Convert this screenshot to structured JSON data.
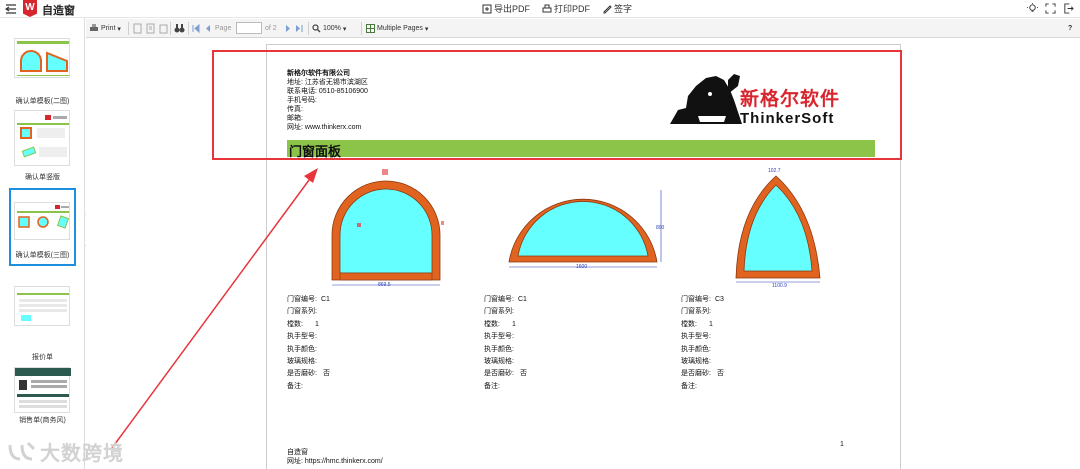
{
  "app": {
    "title": "自造窗",
    "logo_letter": "W",
    "actions": {
      "export_pdf": "导出PDF",
      "print_pdf": "打印PDF",
      "sign": "签字"
    }
  },
  "sidebar": {
    "items": [
      {
        "label": "确认单模板(二图)"
      },
      {
        "label": "确认单竖版"
      },
      {
        "label": "确认单模板(三图)"
      },
      {
        "label": "报价单"
      },
      {
        "label": "销售单(商务风)"
      }
    ],
    "collapse_glyph": "‹"
  },
  "viewer_toolbar": {
    "print": "Print",
    "page_label": "Page",
    "of_pages": "of 2",
    "zoom": "100%",
    "layout": "Multiple Pages",
    "help": "?"
  },
  "doc": {
    "company": {
      "name": "新格尔软件有限公司",
      "address": "地址: 江苏省无锡市滨湖区",
      "phone": "联系电话: 0510-85106900",
      "mobile": "手机号码:",
      "fax": "传真:",
      "email": "邮箱:",
      "website": "网址: www.thinkerx.com"
    },
    "brand": {
      "cn": "新格尔软件",
      "en": "ThinkerSoft"
    },
    "section_title": "门窗面板",
    "windows": [
      {
        "code_label": "门窗编号:",
        "code": "C1",
        "series_label": "门窗系列:",
        "series": "",
        "qty_label": "樘数:",
        "qty": "1",
        "handle_model_label": "执手型号:",
        "handle_model": "",
        "handle_color_label": "执手颜色:",
        "handle_color": "",
        "glass_label": "玻璃规格:",
        "glass": "",
        "frosted_label": "是否磨砂:",
        "frosted": "否",
        "note_label": "备注:",
        "note": "",
        "dims": [
          "869.5"
        ]
      },
      {
        "code_label": "门窗编号:",
        "code": "C1",
        "series_label": "门窗系列:",
        "series": "",
        "qty_label": "樘数:",
        "qty": "1",
        "handle_model_label": "执手型号:",
        "handle_model": "",
        "handle_color_label": "执手颜色:",
        "handle_color": "",
        "glass_label": "玻璃规格:",
        "glass": "",
        "frosted_label": "是否磨砂:",
        "frosted": "否",
        "note_label": "备注:",
        "note": "",
        "dims": [
          "1600",
          "800"
        ]
      },
      {
        "code_label": "门窗编号:",
        "code": "C3",
        "series_label": "门窗系列:",
        "series": "",
        "qty_label": "樘数:",
        "qty": "1",
        "handle_model_label": "执手型号:",
        "handle_model": "",
        "handle_color_label": "执手颜色:",
        "handle_color": "",
        "glass_label": "玻璃规格:",
        "glass": "",
        "frosted_label": "是否磨砂:",
        "frosted": "否",
        "note_label": "备注:",
        "note": "",
        "dims": [
          "102.7",
          "1100.9"
        ]
      }
    ],
    "footer": {
      "brand": "自造窗",
      "url": "网址: https://hmc.thinkerx.com/"
    },
    "page_number": "1"
  },
  "watermark": "大数跨境",
  "colors": {
    "accent_red": "#e8353b",
    "section_green": "#8cc44a",
    "frame_orange": "#e0631f",
    "glass_cyan": "#66ffff",
    "selection_blue": "#1f8fdd"
  }
}
